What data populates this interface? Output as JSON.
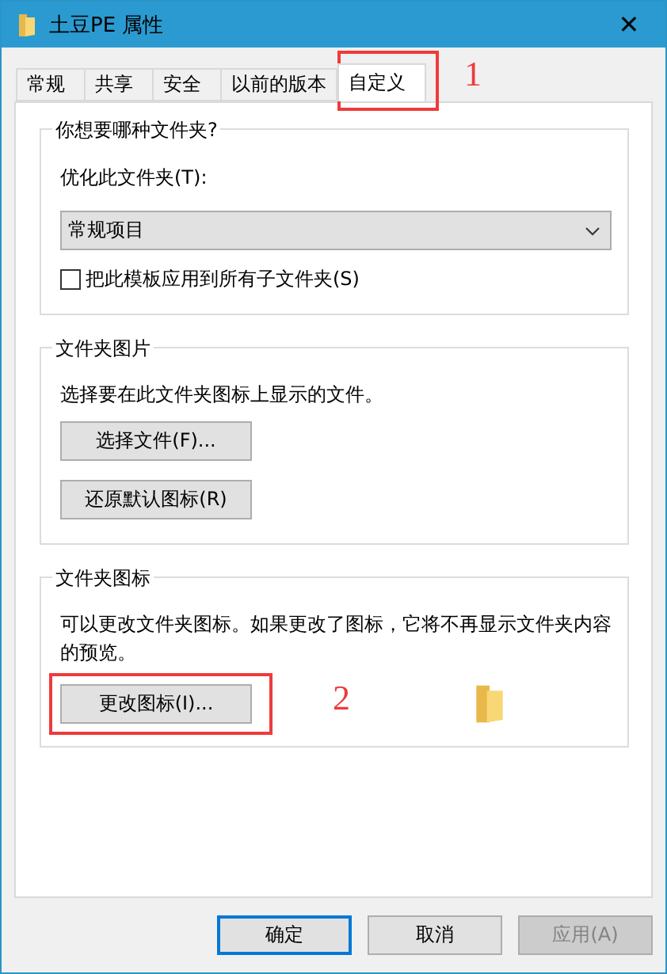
{
  "window": {
    "title": "土豆PE 属性",
    "close": "✕"
  },
  "tabs": [
    {
      "label": "常规",
      "selected": false
    },
    {
      "label": "共享",
      "selected": false
    },
    {
      "label": "安全",
      "selected": false
    },
    {
      "label": "以前的版本",
      "selected": false
    },
    {
      "label": "自定义",
      "selected": true,
      "callout": "1"
    }
  ],
  "folder_type": {
    "title": "你想要哪种文件夹?",
    "label": "优化此文件夹(T):",
    "value": "常规项目",
    "apply_to_subfolders": {
      "label": "把此模板应用到所有子文件夹(S)",
      "checked": false
    }
  },
  "folder_pictures": {
    "title": "文件夹图片",
    "description": "选择要在此文件夹图标上显示的文件。",
    "buttons": [
      {
        "label": "选择文件(F)..."
      },
      {
        "label": "还原默认图标(R)"
      }
    ]
  },
  "folder_icons": {
    "title": "文件夹图标",
    "description": "可以更改文件夹图标。如果更改了图标，它将不再显示文件夹内容的预览。",
    "button": {
      "label": "更改图标(I)...",
      "callout": "2"
    }
  },
  "buttons": [
    {
      "label": "确定",
      "focused": true,
      "disabled": false
    },
    {
      "label": "取消",
      "focused": false,
      "disabled": false
    },
    {
      "label": "应用(A)",
      "focused": false,
      "disabled": true
    }
  ]
}
